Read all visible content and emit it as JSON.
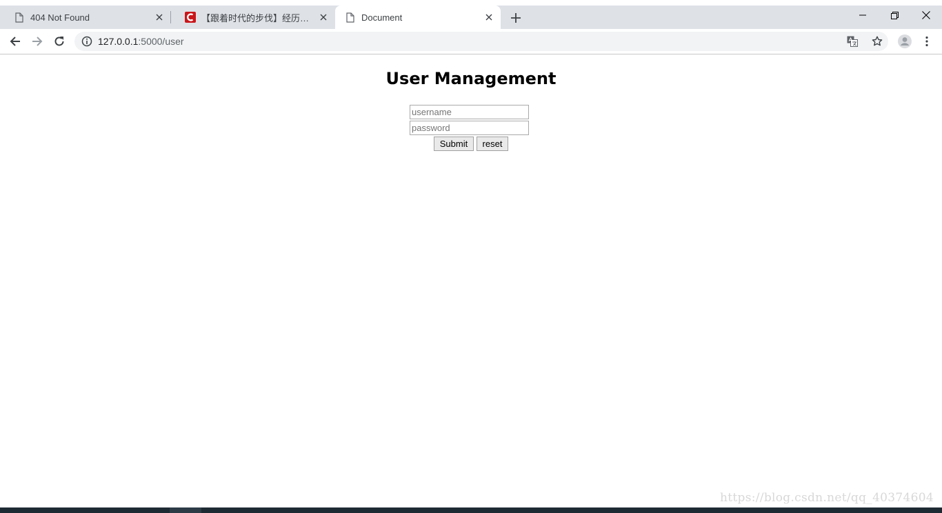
{
  "browser": {
    "tabs": [
      {
        "title": "404 Not Found",
        "icon": "page-icon",
        "active": false
      },
      {
        "title": "【跟着时代的步伐】经历中成长",
        "icon": "csdn-icon",
        "active": false
      },
      {
        "title": "Document",
        "icon": "page-icon",
        "active": true
      }
    ],
    "new_tab_label": "+",
    "address": {
      "host": "127.0.0.1",
      "rest": ":5000/user"
    }
  },
  "page": {
    "heading": "User Management",
    "form": {
      "username_placeholder": "username",
      "password_placeholder": "password",
      "submit_label": "Submit",
      "reset_label": "reset"
    }
  },
  "watermark": "https://blog.csdn.net/qq_40374604",
  "colors": {
    "tabstrip_bg": "#dee1e6",
    "omnibox_bg": "#f1f3f4",
    "csdn_red": "#c9171b"
  }
}
